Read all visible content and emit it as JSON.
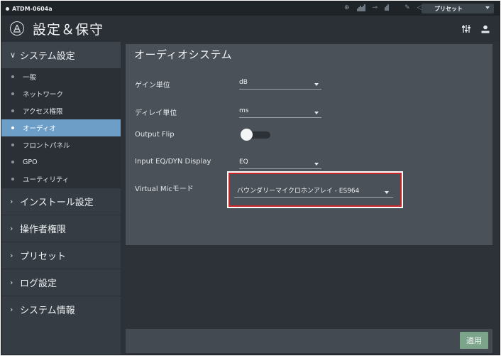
{
  "topbar": {
    "device_name": "ATDM-0604a",
    "preset_label": "プリセット"
  },
  "titlebar": {
    "title": "設定＆保守"
  },
  "sidebar": {
    "system_settings": "システム設定",
    "items": [
      {
        "label": "一般",
        "active": false
      },
      {
        "label": "ネットワーク",
        "active": false
      },
      {
        "label": "アクセス権限",
        "active": false
      },
      {
        "label": "オーディオ",
        "active": true
      },
      {
        "label": "フロントパネル",
        "active": false
      },
      {
        "label": "GPO",
        "active": false
      },
      {
        "label": "ユーティリティ",
        "active": false
      }
    ],
    "install_settings": "インストール設定",
    "operator_permissions": "操作者権限",
    "preset": "プリセット",
    "log_settings": "ログ設定",
    "system_info": "システム情報"
  },
  "main": {
    "heading": "オーディオシステム",
    "gain_unit_label": "ゲイン単位",
    "gain_unit_value": "dB",
    "delay_unit_label": "ディレイ単位",
    "delay_unit_value": "ms",
    "output_flip_label": "Output Flip",
    "output_flip_on": true,
    "input_eq_label": "Input EQ/DYN Display",
    "input_eq_value": "EQ",
    "virtual_mic_label": "Virtual Micモード",
    "virtual_mic_value": "バウンダリーマイクロホンアレイ - ES964"
  },
  "bottom": {
    "apply_label": "適用"
  },
  "colors": {
    "active_item": "#6d9ec7",
    "apply_button": "#7ba48a",
    "highlight_border": "#c8262b"
  }
}
